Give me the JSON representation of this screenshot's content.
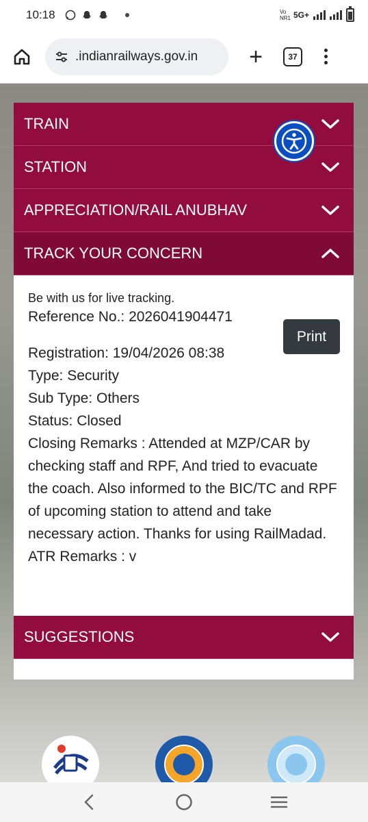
{
  "status_bar": {
    "time": "10:18",
    "network": "5G+",
    "volte": "Vo NR1"
  },
  "browser": {
    "url": "​.indianrailways.gov.in",
    "tab_count": "37"
  },
  "accordion": {
    "train": "TRAIN",
    "station": "STATION",
    "appreciation": "APPRECIATION/RAIL ANUBHAV",
    "track": "TRACK YOUR CONCERN",
    "suggestions": "SUGGESTIONS"
  },
  "track": {
    "tagline": "Be with us for live tracking.",
    "reference": "Reference No.: 2026041904471",
    "print_label": "Print",
    "registration": "Registration: 19/04/2026 08:38",
    "type": "Type: Security",
    "sub_type": "Sub Type: Others",
    "status": "Status: Closed",
    "closing_remarks": "Closing Remarks : Attended at MZP/CAR by checking staff and RPF, And tried to evacuate the coach. Also informed to the BIC/TC and RPF of upcoming station to attend and take necessary action. Thanks for using RailMadad.",
    "atr_remarks": "ATR Remarks : v"
  },
  "colors": {
    "accent": "#930c3e",
    "accent_active": "#7f0a35",
    "print_button": "#343a40",
    "a11y": "#0b4ec0"
  },
  "icons": [
    "home-icon",
    "site-settings-icon",
    "plus-icon",
    "tabs-icon",
    "menu-icon",
    "chevron-down-icon",
    "chevron-up-icon",
    "accessibility-icon",
    "back-icon",
    "home-circle-icon",
    "recents-icon"
  ]
}
